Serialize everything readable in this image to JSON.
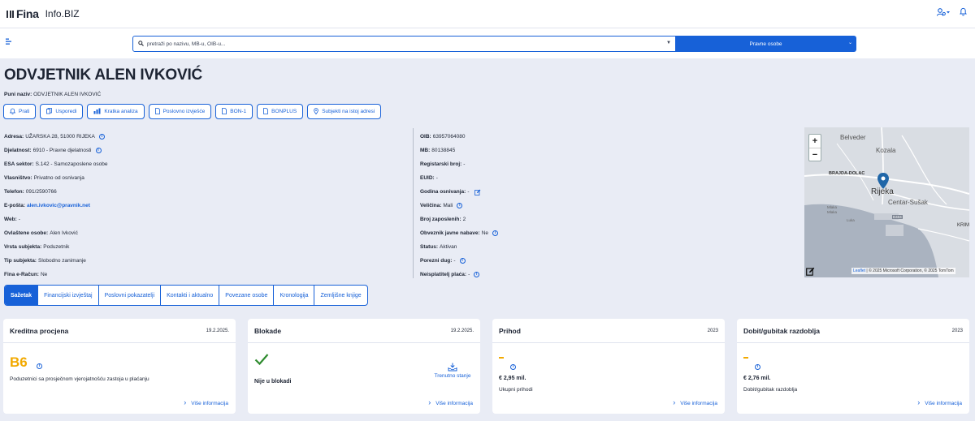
{
  "header": {
    "logo": "Fina",
    "app_name": "Info.BIZ"
  },
  "search": {
    "placeholder": "pretraži po nazivu, MB-u, OIB-u...",
    "type": "Pravne osobe"
  },
  "entity": {
    "title": "ODVJETNIK ALEN IVKOVIĆ",
    "full_name_label": "Puni naziv:",
    "full_name": "ODVJETNIK ALEN IVKOVIĆ"
  },
  "actions": [
    {
      "label": "Prati",
      "icon": "bell-icon"
    },
    {
      "label": "Usporedi",
      "icon": "copy-icon"
    },
    {
      "label": "Kratka analiza",
      "icon": "chart-icon"
    },
    {
      "label": "Poslovno izvješće",
      "icon": "document-icon"
    },
    {
      "label": "BON-1",
      "icon": "document-icon"
    },
    {
      "label": "BONPLUS",
      "icon": "document-icon"
    },
    {
      "label": "Subjekti na istoj adresi",
      "icon": "location-pin-icon"
    }
  ],
  "details_left": [
    {
      "label": "Adresa:",
      "value": "UŽARSKA 28, 51000 RIJEKA",
      "info": true
    },
    {
      "label": "Djelatnost:",
      "value": "6910 - Pravne djelatnosti",
      "info": true
    },
    {
      "label": "ESA sektor:",
      "value": "S.142 - Samozaposlene osobe"
    },
    {
      "label": "Vlasništvo:",
      "value": "Privatno od osnivanja"
    },
    {
      "label": "Telefon:",
      "value": "091/2590766"
    },
    {
      "label": "E-pošta:",
      "value": "alen.ivkovic@pravnik.net",
      "link": true
    },
    {
      "label": "Web:",
      "value": "-"
    },
    {
      "label": "Ovlaštene osobe:",
      "value": "Alen Ivković"
    },
    {
      "label": "Vrsta subjekta:",
      "value": "Poduzetnik"
    },
    {
      "label": "Tip subjekta:",
      "value": "Slobodno zanimanje"
    },
    {
      "label": "Fina e-Račun:",
      "value": "Ne"
    }
  ],
  "details_right": [
    {
      "label": "OIB:",
      "value": "63957064080"
    },
    {
      "label": "MB:",
      "value": "80138845"
    },
    {
      "label": "Registarski broj:",
      "value": "-"
    },
    {
      "label": "EUID:",
      "value": "-"
    },
    {
      "label": "Godina osnivanja:",
      "value": "-",
      "edit": true
    },
    {
      "label": "Veličina:",
      "value": "Mali",
      "info": true
    },
    {
      "label": "Broj zaposlenih:",
      "value": "2"
    },
    {
      "label": "Obveznik javne nabave:",
      "value": "Ne",
      "info": true
    },
    {
      "label": "Status:",
      "value": "Aktivan"
    },
    {
      "label": "Porezni dug:",
      "value": "-",
      "info": true
    },
    {
      "label": "Neisplatitelj plaća:",
      "value": "-",
      "info": true
    }
  ],
  "map": {
    "labels": [
      "Belveder",
      "Kozala",
      "BRAJDA-DOLAC",
      "Rijeka",
      "Centar-Sušak",
      "Mlaka",
      "Mlaka",
      "Luka",
      "KRIM",
      "D404"
    ],
    "zoom_in": "+",
    "zoom_out": "−",
    "attribution_link": "Leaflet",
    "attribution": "| © 2025 Microsoft Corporation, © 2025 TomTom",
    "colors": {
      "water": "#aab3c0",
      "land": "#d9dde3",
      "road": "#ffffff",
      "pin": "#1f66a8"
    }
  },
  "tabs": [
    {
      "label": "Sažetak",
      "active": true
    },
    {
      "label": "Financijski izvještaj"
    },
    {
      "label": "Poslovni pokazatelji"
    },
    {
      "label": "Kontakti i aktualno"
    },
    {
      "label": "Povezane osobe"
    },
    {
      "label": "Kronologija"
    },
    {
      "label": "Zemljišne knjige"
    }
  ],
  "cards": {
    "credit": {
      "title": "Kreditna procjena",
      "date": "19.2.2025.",
      "rating": "B6",
      "description": "Poduzetnici sa prosječnom vjerojatnošću zastoja u plaćanju",
      "more": "Više informacija"
    },
    "block": {
      "title": "Blokade",
      "date": "19.2.2025.",
      "status": "Nije u blokadi",
      "current": "Trenutno stanje",
      "more": "Više informacija"
    },
    "revenue": {
      "title": "Prihod",
      "year": "2023",
      "amount": "€ 2,95 mil.",
      "sub": "Ukupni prihodi",
      "more": "Više informacija"
    },
    "profit": {
      "title": "Dobit/gubitak razdoblja",
      "year": "2023",
      "amount": "€ 2,76 mil.",
      "sub": "Dobit/gubitak razdoblja",
      "more": "Više informacija"
    }
  },
  "colors": {
    "accent": "#1761d8",
    "rating": "#f2a900",
    "check": "#2e8b2e",
    "background": "#e9ecf5"
  }
}
